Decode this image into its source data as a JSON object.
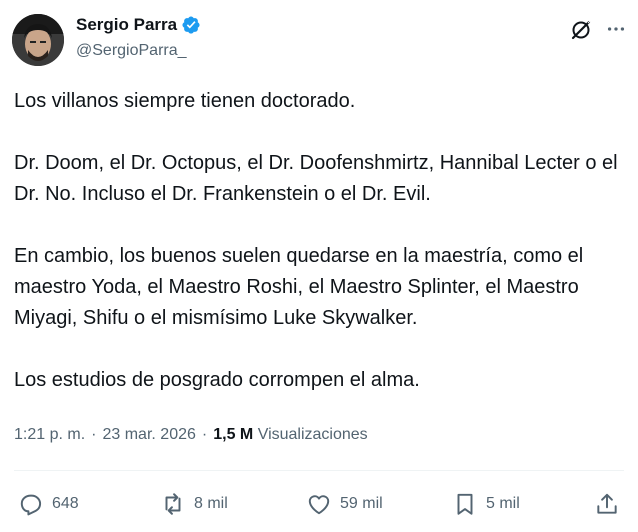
{
  "author": {
    "display_name": "Sergio Parra",
    "handle": "@SergioParra_",
    "verified_color": "#1d9bf0"
  },
  "header": {
    "grok_icon": "grok-icon",
    "more_icon": "more-horizontal-icon"
  },
  "tweet": {
    "paragraphs": [
      "Los villanos siempre tienen doctorado.",
      "Dr. Doom, el Dr. Octopus, el Dr. Doofenshmirtz, Hannibal Lecter o el Dr. No. Incluso el Dr. Frankenstein o el Dr. Evil.",
      "En cambio, los buenos suelen quedarse en la maestría, como el maestro Yoda, el Maestro Roshi, el Maestro Splinter, el Maestro Miyagi, Shifu o el mismísimo Luke Skywalker.",
      "Los estudios de posgrado corrompen el alma."
    ]
  },
  "meta": {
    "time": "1:21 p. m.",
    "separator": "·",
    "date": "23 mar. 2026",
    "views_count": "1,5 M",
    "views_label": "Visualizaciones"
  },
  "actions": {
    "replies": "648",
    "reposts": "8 mil",
    "likes": "59 mil",
    "bookmarks": "5 mil"
  },
  "colors": {
    "text_primary": "#0f1419",
    "text_secondary": "#536471",
    "divider": "#eff3f4",
    "accent": "#1d9bf0"
  }
}
